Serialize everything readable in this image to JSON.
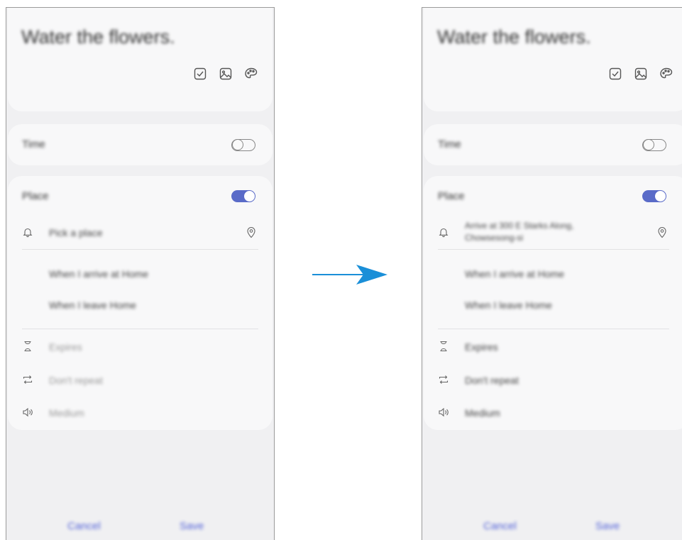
{
  "before": {
    "title": "Water the flowers.",
    "time_label": "Time",
    "place_label": "Place",
    "location_text": "Pick a place",
    "option_arrive": "When I arrive at Home",
    "option_leave": "When I leave Home",
    "expire_text": "Expires",
    "repeat_text": "Don't repeat",
    "sound_text": "Medium",
    "cancel_label": "Cancel",
    "save_label": "Save"
  },
  "after": {
    "title": "Water the flowers.",
    "time_label": "Time",
    "place_label": "Place",
    "location_line1": "Arrive at 300 E Starks Along,",
    "location_line2": "Chowsesong-si",
    "option_arrive": "When I arrive at Home",
    "option_leave": "When I leave Home",
    "expire_text": "Expires",
    "repeat_text": "Don't repeat",
    "sound_text": "Medium",
    "cancel_label": "Cancel",
    "save_label": "Save"
  },
  "colors": {
    "toggle_on": "#5a6bc8",
    "button_text": "#5060d8",
    "arrow": "#1a8fd8"
  }
}
